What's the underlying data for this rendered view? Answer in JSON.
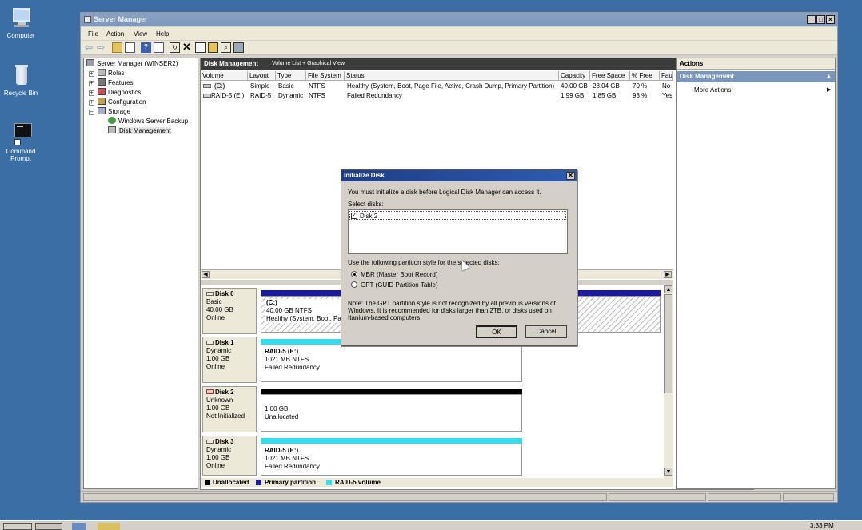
{
  "desktop": {
    "icons": [
      {
        "label": "Computer",
        "icon": "computer-icon"
      },
      {
        "label": "Recycle Bin",
        "icon": "recycle-bin-icon"
      },
      {
        "label": "Command Prompt",
        "icon": "command-prompt-icon"
      }
    ]
  },
  "window": {
    "title": "Server Manager",
    "controls": {
      "minimize": "_",
      "maximize": "□",
      "close": "×"
    },
    "menu": [
      "File",
      "Action",
      "View",
      "Help"
    ]
  },
  "tree": {
    "items": [
      {
        "label": "Server Manager (WINSER2)",
        "icon": "server-manager-icon"
      },
      {
        "label": "Roles",
        "icon": "roles-icon"
      },
      {
        "label": "Features",
        "icon": "features-icon"
      },
      {
        "label": "Diagnostics",
        "icon": "diagnostics-icon"
      },
      {
        "label": "Configuration",
        "icon": "configuration-icon"
      },
      {
        "label": "Storage",
        "icon": "storage-icon"
      },
      {
        "label": "Windows Server Backup",
        "icon": "backup-icon"
      },
      {
        "label": "Disk Management",
        "icon": "disk-management-icon"
      }
    ]
  },
  "center": {
    "title": "Disk Management",
    "subtitle": "Volume List + Graphical View",
    "columns": [
      "Volume",
      "Layout",
      "Type",
      "File System",
      "Status",
      "Capacity",
      "Free Space",
      "% Free",
      "Fau"
    ],
    "rows": [
      [
        "(C:)",
        "Simple",
        "Basic",
        "NTFS",
        "Healthy (System, Boot, Page File, Active, Crash Dump, Primary Partition)",
        "40.00 GB",
        "28.04 GB",
        "70 %",
        "No"
      ],
      [
        "RAID-5 (E:)",
        "RAID-5",
        "Dynamic",
        "NTFS",
        "Failed Redundancy",
        "1.99 GB",
        "1.85 GB",
        "93 %",
        "Yes"
      ]
    ],
    "disks": [
      {
        "name": "Disk 0",
        "type": "Basic",
        "size": "40.00 GB",
        "state": "Online",
        "part": {
          "name": "(C:)",
          "line2": "40.00 GB NTFS",
          "line3": "Healthy (System, Boot, Pag"
        }
      },
      {
        "name": "Disk 1",
        "type": "Dynamic",
        "size": "1.00 GB",
        "state": "Online",
        "part": {
          "name": "RAID-5  (E:)",
          "line2": "1021 MB NTFS",
          "line3": "Failed Redundancy"
        }
      },
      {
        "name": "Disk 2",
        "type": "Unknown",
        "size": "1.00 GB",
        "state": "Not Initialized",
        "part": {
          "name": "",
          "line2": "1.00 GB",
          "line3": "Unallocated"
        }
      },
      {
        "name": "Disk 3",
        "type": "Dynamic",
        "size": "1.00 GB",
        "state": "Online",
        "part": {
          "name": "RAID-5  (E:)",
          "line2": "1021 MB NTFS",
          "line3": "Failed Redundancy"
        }
      }
    ],
    "legend": [
      {
        "label": "Unallocated",
        "color": "#000000"
      },
      {
        "label": "Primary partition",
        "color": "#1a1aa0"
      },
      {
        "label": "RAID-5 volume",
        "color": "#33ddee"
      }
    ]
  },
  "actions": {
    "header": "Actions",
    "section": "Disk Management",
    "more": "More Actions"
  },
  "dialog": {
    "title": "Initialize Disk",
    "message": "You must initialize a disk before Logical Disk Manager can access it.",
    "select_label": "Select disks:",
    "disks": [
      {
        "label": "Disk 2",
        "checked": true
      }
    ],
    "style_label": "Use the following partition style for the selected disks:",
    "options": [
      {
        "label": "MBR (Master Boot Record)",
        "selected": true
      },
      {
        "label": "GPT (GUID Partition Table)",
        "selected": false
      }
    ],
    "note_lines": [
      "Note: The GPT partition style is not recognized by all previous versions of",
      "Windows. It is recommended for disks larger than 2TB, or disks used on",
      "Itanium-based computers."
    ],
    "ok": "OK",
    "cancel": "Cancel"
  },
  "taskbar": {
    "clock": "3:33 PM"
  },
  "colors": {
    "desktop": "#3a6ea5",
    "primary_partition": "#1a1aa0",
    "raid5": "#33ddee",
    "unallocated": "#000000",
    "actions_header": "#7b96bb"
  }
}
